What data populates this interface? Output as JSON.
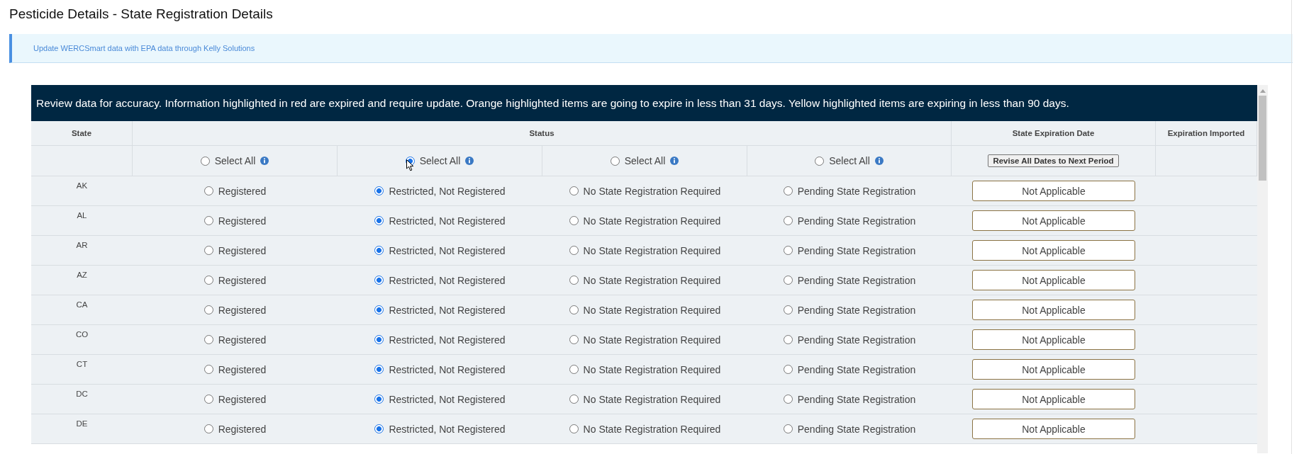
{
  "page_title": "Pesticide Details - State Registration Details",
  "alert": {
    "link": "Update WERCSmart data with EPA data through Kelly Solutions"
  },
  "panel": {
    "notice": "Review data for accuracy. Information highlighted in red are expired and require update. Orange highlighted items are going to expire in less than 31 days. Yellow highlighted items are expiring in less than 90 days.",
    "columns": [
      "State",
      "Status",
      "State Expiration Date",
      "Expiration Imported"
    ],
    "select_all": [
      {
        "label": "Select All",
        "selected": false
      },
      {
        "label": "Select All",
        "selected": true
      },
      {
        "label": "Select All",
        "selected": false
      },
      {
        "label": "Select All",
        "selected": false
      }
    ],
    "revise_button": "Revise All Dates to Next Period",
    "rows": [
      {
        "state": "AK",
        "options": [
          {
            "label": "Registered",
            "selected": false
          },
          {
            "label": "Restricted, Not Registered",
            "selected": true
          },
          {
            "label": "No State Registration Required",
            "selected": false
          },
          {
            "label": "Pending State Registration",
            "selected": false
          }
        ],
        "expiration": "Not Applicable"
      },
      {
        "state": "AL",
        "options": [
          {
            "label": "Registered",
            "selected": false
          },
          {
            "label": "Restricted, Not Registered",
            "selected": true
          },
          {
            "label": "No State Registration Required",
            "selected": false
          },
          {
            "label": "Pending State Registration",
            "selected": false
          }
        ],
        "expiration": "Not Applicable"
      },
      {
        "state": "AR",
        "options": [
          {
            "label": "Registered",
            "selected": false
          },
          {
            "label": "Restricted, Not Registered",
            "selected": true
          },
          {
            "label": "No State Registration Required",
            "selected": false
          },
          {
            "label": "Pending State Registration",
            "selected": false
          }
        ],
        "expiration": "Not Applicable"
      },
      {
        "state": "AZ",
        "options": [
          {
            "label": "Registered",
            "selected": false
          },
          {
            "label": "Restricted, Not Registered",
            "selected": true
          },
          {
            "label": "No State Registration Required",
            "selected": false
          },
          {
            "label": "Pending State Registration",
            "selected": false
          }
        ],
        "expiration": "Not Applicable"
      },
      {
        "state": "CA",
        "options": [
          {
            "label": "Registered",
            "selected": false
          },
          {
            "label": "Restricted, Not Registered",
            "selected": true
          },
          {
            "label": "No State Registration Required",
            "selected": false
          },
          {
            "label": "Pending State Registration",
            "selected": false
          }
        ],
        "expiration": "Not Applicable"
      },
      {
        "state": "CO",
        "options": [
          {
            "label": "Registered",
            "selected": false
          },
          {
            "label": "Restricted, Not Registered",
            "selected": true
          },
          {
            "label": "No State Registration Required",
            "selected": false
          },
          {
            "label": "Pending State Registration",
            "selected": false
          }
        ],
        "expiration": "Not Applicable"
      },
      {
        "state": "CT",
        "options": [
          {
            "label": "Registered",
            "selected": false
          },
          {
            "label": "Restricted, Not Registered",
            "selected": true
          },
          {
            "label": "No State Registration Required",
            "selected": false
          },
          {
            "label": "Pending State Registration",
            "selected": false
          }
        ],
        "expiration": "Not Applicable"
      },
      {
        "state": "DC",
        "options": [
          {
            "label": "Registered",
            "selected": false
          },
          {
            "label": "Restricted, Not Registered",
            "selected": true
          },
          {
            "label": "No State Registration Required",
            "selected": false
          },
          {
            "label": "Pending State Registration",
            "selected": false
          }
        ],
        "expiration": "Not Applicable"
      },
      {
        "state": "DE",
        "options": [
          {
            "label": "Registered",
            "selected": false
          },
          {
            "label": "Restricted, Not Registered",
            "selected": true
          },
          {
            "label": "No State Registration Required",
            "selected": false
          },
          {
            "label": "Pending State Registration",
            "selected": false
          }
        ],
        "expiration": "Not Applicable"
      }
    ]
  }
}
